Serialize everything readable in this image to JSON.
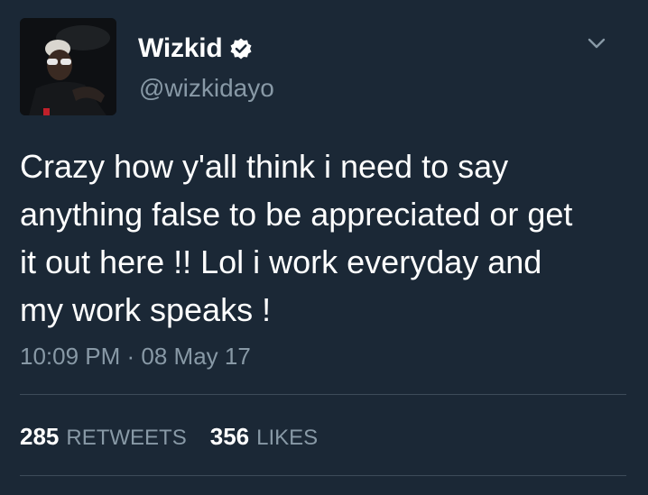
{
  "tweet": {
    "author": {
      "display_name": "Wizkid",
      "handle": "@wizkidayo",
      "verified_icon": "verified-badge-icon"
    },
    "menu_icon": "chevron-down-icon",
    "text_lines": [
      "Crazy how y'all think i need to say",
      "anything false to be appreciated or get",
      "it out here !! Lol i work everyday and",
      "my work speaks !"
    ],
    "timestamp": "10:09 PM · 08 May 17",
    "stats": {
      "retweets_count": "285",
      "retweets_label": "RETWEETS",
      "likes_count": "356",
      "likes_label": "LIKES"
    }
  },
  "colors": {
    "background": "#1b2836",
    "primary_text": "#ffffff",
    "secondary_text": "#8899a6",
    "divider": "#3d4b59"
  }
}
